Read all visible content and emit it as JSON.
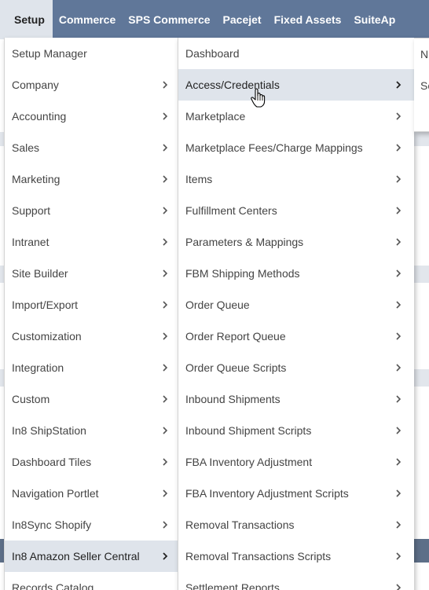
{
  "nav": {
    "tabs": [
      "Setup",
      "Commerce",
      "SPS Commerce",
      "Pacejet",
      "Fixed Assets",
      "SuiteAp"
    ],
    "active_index": 0
  },
  "menu": {
    "col1": [
      "Setup Manager",
      "Company",
      "Accounting",
      "Sales",
      "Marketing",
      "Support",
      "Intranet",
      "Site Builder",
      "Import/Export",
      "Customization",
      "Integration",
      "Custom",
      "In8 ShipStation",
      "Dashboard Tiles",
      "Navigation Portlet",
      "In8Sync Shopify",
      "In8 Amazon Seller Central",
      "Records Catalog"
    ],
    "col1_active": "In8 Amazon Seller Central",
    "col2": [
      "Dashboard",
      "Access/Credentials",
      "Marketplace",
      "Marketplace Fees/Charge Mappings",
      "Items",
      "Fulfillment Centers",
      "Parameters & Mappings",
      "FBM Shipping Methods",
      "Order Queue",
      "Order Report Queue",
      "Order Queue Scripts",
      "Inbound Shipments",
      "Inbound Shipment Scripts",
      "FBA Inventory Adjustment",
      "FBA Inventory Adjustment Scripts",
      "Removal Transactions",
      "Removal Transactions Scripts",
      "Settlement Reports"
    ],
    "col2_hover": "Access/Credentials",
    "col3": [
      "N",
      "Se"
    ]
  },
  "colors": {
    "nav_bg": "#607799",
    "highlight": "#dfe4eb"
  }
}
